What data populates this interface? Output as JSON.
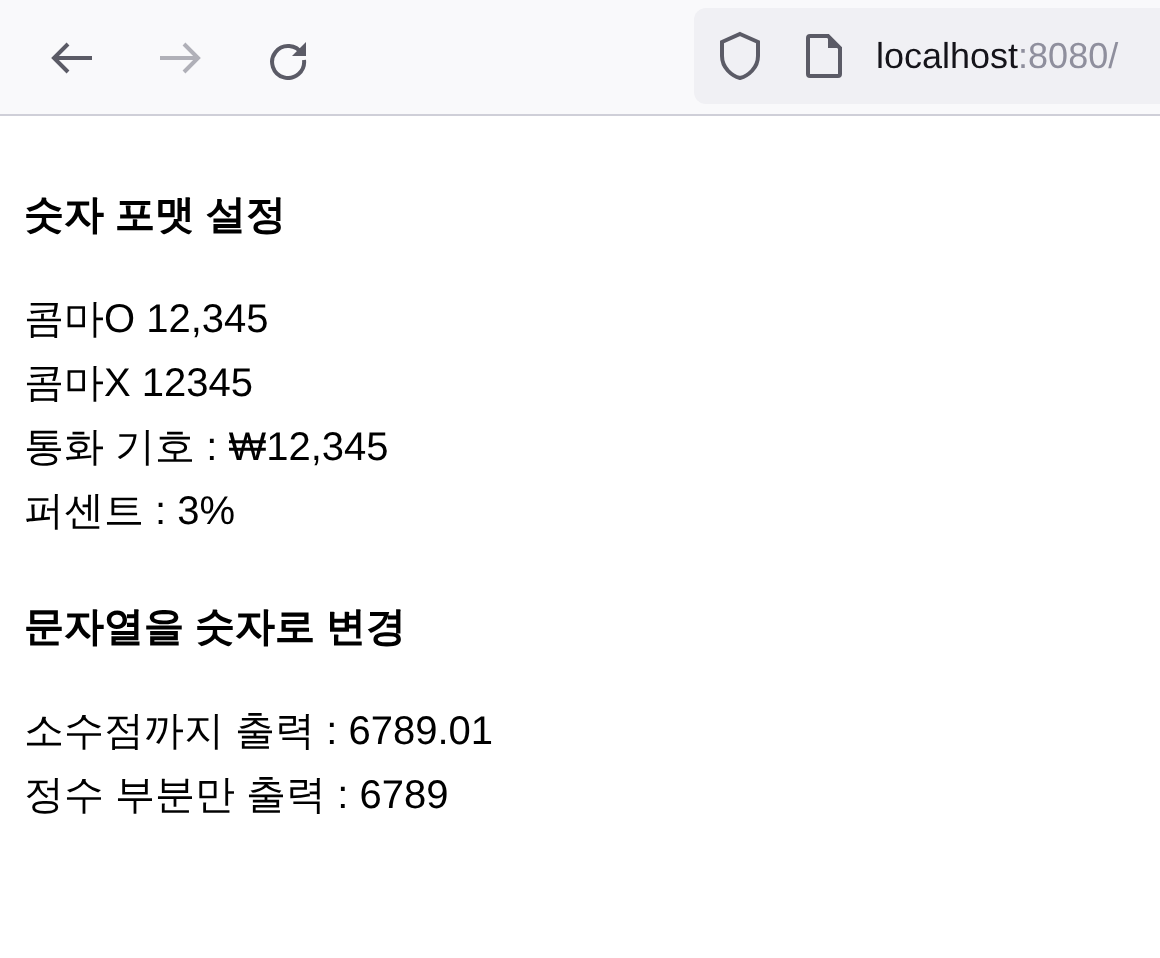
{
  "toolbar": {
    "back": {
      "disabled": false
    },
    "forward": {
      "disabled": true
    },
    "address": {
      "host": "localhost",
      "port": ":8080/"
    }
  },
  "sections": [
    {
      "heading": "숫자 포맷 설정",
      "lines": [
        "콤마O 12,345",
        "콤마X 12345",
        "통화 기호 : ₩12,345",
        "퍼센트 : 3%"
      ]
    },
    {
      "heading": "문자열을 숫자로 변경",
      "lines": [
        "소수점까지 출력 : 6789.01",
        "정수 부분만 출력 : 6789"
      ]
    }
  ]
}
